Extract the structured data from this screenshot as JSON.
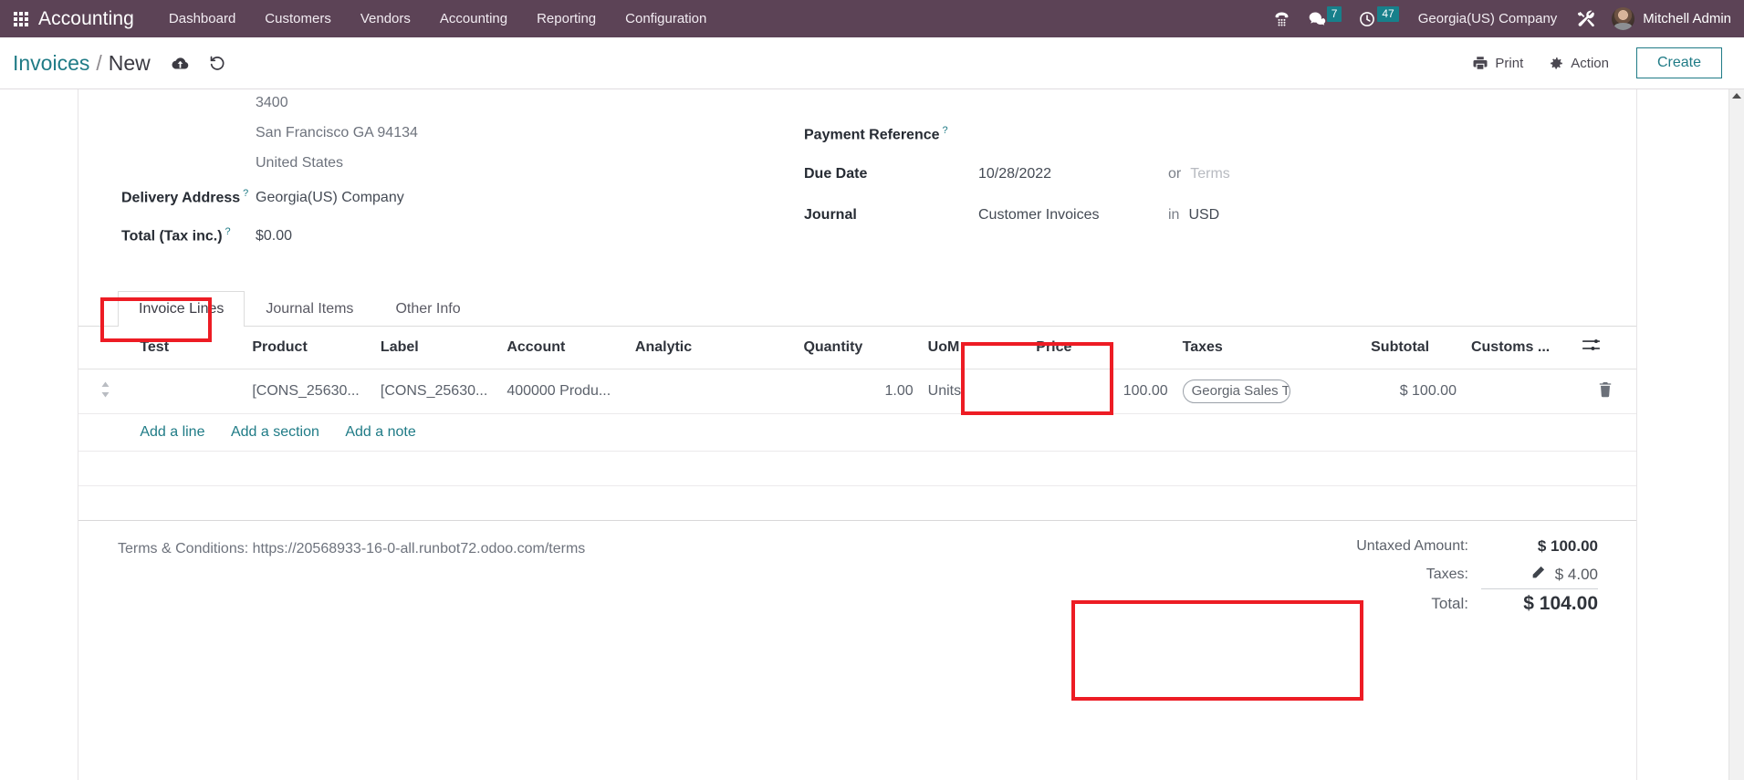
{
  "navbar": {
    "apps_icon": "apps-grid-icon",
    "brand": "Accounting",
    "menu": [
      {
        "label": "Dashboard"
      },
      {
        "label": "Customers"
      },
      {
        "label": "Vendors"
      },
      {
        "label": "Accounting"
      },
      {
        "label": "Reporting"
      },
      {
        "label": "Configuration"
      }
    ],
    "systray": {
      "dialpad_icon": "phone-dialpad-icon",
      "messages_icon": "chat-bubble-icon",
      "messages_count": "7",
      "activities_icon": "clock-icon",
      "activities_count": "47",
      "company": "Georgia(US) Company",
      "debug_icon": "tools-wrench-icon",
      "user_name": "Mitchell Admin",
      "avatar_icon": "user-avatar"
    },
    "accent_purple": "#5c4356",
    "badge_teal": "#17808b"
  },
  "control_panel": {
    "breadcrumb_root": "Invoices",
    "breadcrumb_separator": "/",
    "breadcrumb_current": "New",
    "save_icon": "cloud-upload-icon",
    "discard_icon": "undo-arrow-icon",
    "print_label": "Print",
    "print_icon": "printer-icon",
    "action_label": "Action",
    "action_icon": "gear-icon",
    "create_label": "Create",
    "accent_teal": "#1f7b86"
  },
  "form": {
    "address_lines": [
      "3400",
      "San Francisco GA 94134",
      "United States"
    ],
    "delivery_address": {
      "label": "Delivery Address",
      "tooltip": "?",
      "value": "Georgia(US) Company"
    },
    "total_tax_inc": {
      "label": "Total (Tax inc.)",
      "tooltip": "?",
      "value": "$0.00"
    },
    "payment_reference": {
      "label": "Payment Reference",
      "tooltip": "?",
      "value": ""
    },
    "due_date": {
      "label": "Due Date",
      "value": "10/28/2022"
    },
    "or_word": "or",
    "terms_placeholder": "Terms",
    "journal": {
      "label": "Journal",
      "value": "Customer Invoices"
    },
    "in_word": "in",
    "currency": "USD"
  },
  "tabs": [
    {
      "label": "Invoice Lines",
      "active": true
    },
    {
      "label": "Journal Items",
      "active": false
    },
    {
      "label": "Other Info",
      "active": false
    }
  ],
  "lines_table": {
    "headers": {
      "handle": "",
      "test": "Test",
      "product": "Product",
      "label": "Label",
      "account": "Account",
      "analytic": "Analytic",
      "quantity": "Quantity",
      "uom": "UoM",
      "price": "Price",
      "taxes": "Taxes",
      "subtotal": "Subtotal",
      "customs": "Customs ...",
      "optional_columns_icon": "sliders-toggle-icon"
    },
    "rows": [
      {
        "handle_icon": "drag-handle-icon",
        "test": "",
        "product": "[CONS_25630...",
        "label": "[CONS_25630...",
        "account": "400000 Produ...",
        "analytic": "",
        "quantity": "1.00",
        "uom": "Units",
        "price": "100.00",
        "tax_tag": "Georgia Sales Ta",
        "subtotal": "$ 100.00",
        "customs": "",
        "delete_icon": "trash-icon"
      }
    ],
    "add_line": "Add a line",
    "add_section": "Add a section",
    "add_note": "Add a note"
  },
  "footer": {
    "terms_text": "Terms & Conditions: https://20568933-16-0-all.runbot72.odoo.com/terms",
    "totals": {
      "untaxed_label": "Untaxed Amount:",
      "untaxed_value": "$ 100.00",
      "taxes_label": "Taxes:",
      "taxes_value": "$ 4.00",
      "taxes_edit_icon": "pencil-icon",
      "total_label": "Total:",
      "total_value": "$ 104.00"
    }
  },
  "annotations": {
    "highlight_color": "#ed1c24",
    "boxes": [
      "invoice-lines-tab",
      "taxes-column",
      "totals-summary"
    ]
  }
}
